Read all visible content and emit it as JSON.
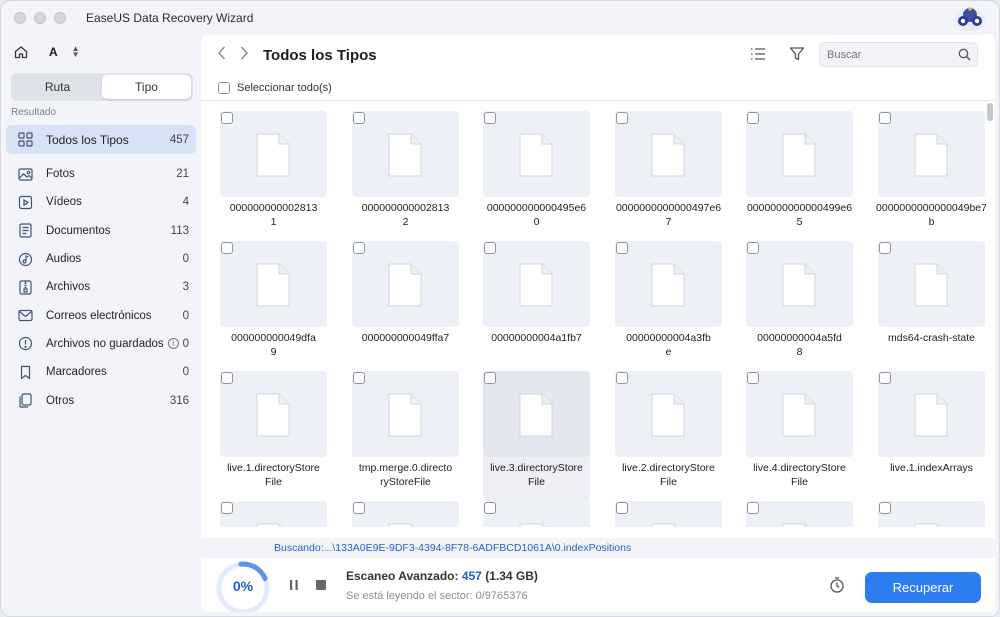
{
  "app": {
    "title": "EaseUS Data Recovery Wizard"
  },
  "sidebar": {
    "drive": "A",
    "segments": {
      "left": "Ruta",
      "right": "Tipo",
      "active": "Tipo"
    },
    "section_label": "Resultado",
    "items": [
      {
        "icon": "grid-icon",
        "label": "Todos los Tipos",
        "count": "457"
      },
      {
        "icon": "photo-icon",
        "label": "Fotos",
        "count": "21"
      },
      {
        "icon": "video-icon",
        "label": "Vídeos",
        "count": "4"
      },
      {
        "icon": "document-icon",
        "label": "Documentos",
        "count": "113"
      },
      {
        "icon": "audio-icon",
        "label": "Audios",
        "count": "0"
      },
      {
        "icon": "archive-icon",
        "label": "Archivos",
        "count": "3"
      },
      {
        "icon": "mail-icon",
        "label": "Correos electrónicos",
        "count": "0"
      },
      {
        "icon": "unsaved-icon",
        "label": "Archivos no guardados",
        "count": "0"
      },
      {
        "icon": "bookmark-icon",
        "label": "Marcadores",
        "count": "0"
      },
      {
        "icon": "other-icon",
        "label": "Otros",
        "count": "316"
      }
    ]
  },
  "main": {
    "title": "Todos los Tipos",
    "search_placeholder": "Buscar",
    "select_all": "Seleccionar todo(s)",
    "files": [
      "0000000000028131",
      "0000000000028132",
      "000000000000495e60",
      "0000000000000497e67",
      "0000000000000499e65",
      "0000000000000049be7b",
      "0000000000049dfa9",
      "000000000049ffa7",
      "00000000004a1fb7",
      "00000000004a3fbe",
      "00000000004a5fd8",
      "mds64-crash-state",
      "live.1.directoryStoreFile",
      "tmp.merge.0.directoryStoreFile",
      "live.3.directoryStoreFile",
      "live.2.directoryStoreFile",
      "live.4.directoryStoreFile",
      "live.1.indexArrays",
      "",
      "",
      "",
      "",
      "",
      ""
    ],
    "file_lines": [
      [
        "000000000002813",
        "1"
      ],
      [
        "000000000002813",
        "2"
      ],
      [
        "000000000000495e6",
        "0"
      ],
      [
        "0000000000000497e6",
        "7"
      ],
      [
        "0000000000000499e6",
        "5"
      ],
      [
        "0000000000000049be7",
        "b"
      ],
      [
        "000000000049dfa",
        "9"
      ],
      [
        "000000000049ffa7",
        ""
      ],
      [
        "00000000004a1fb7",
        ""
      ],
      [
        "00000000004a3fb",
        "e"
      ],
      [
        "00000000004a5fd",
        "8"
      ],
      [
        "mds64-crash-state",
        ""
      ],
      [
        "live.1.directoryStore",
        "File"
      ],
      [
        "tmp.merge.0.directo",
        "ryStoreFile"
      ],
      [
        "live.3.directoryStore",
        "File"
      ],
      [
        "live.2.directoryStore",
        "File"
      ],
      [
        "live.4.directoryStore",
        "File"
      ],
      [
        "live.1.indexArrays",
        ""
      ]
    ],
    "hovered_index": 14
  },
  "status": {
    "path": "Buscando:...\\133A0E9E-9DF3-4394-8F78-6ADFBCD1061A\\0.indexPositions",
    "progress_pct": "0%",
    "scan_label": "Escaneo Avanzado:",
    "scan_count": "457",
    "scan_size": "(1.34 GB)",
    "sector_text": "Se está leyendo el sector: 0/9765376",
    "recover_label": "Recuperar"
  },
  "colors": {
    "accent": "#2d7cf0",
    "link": "#2260c9",
    "sidebar_active": "#d8e2f6"
  }
}
